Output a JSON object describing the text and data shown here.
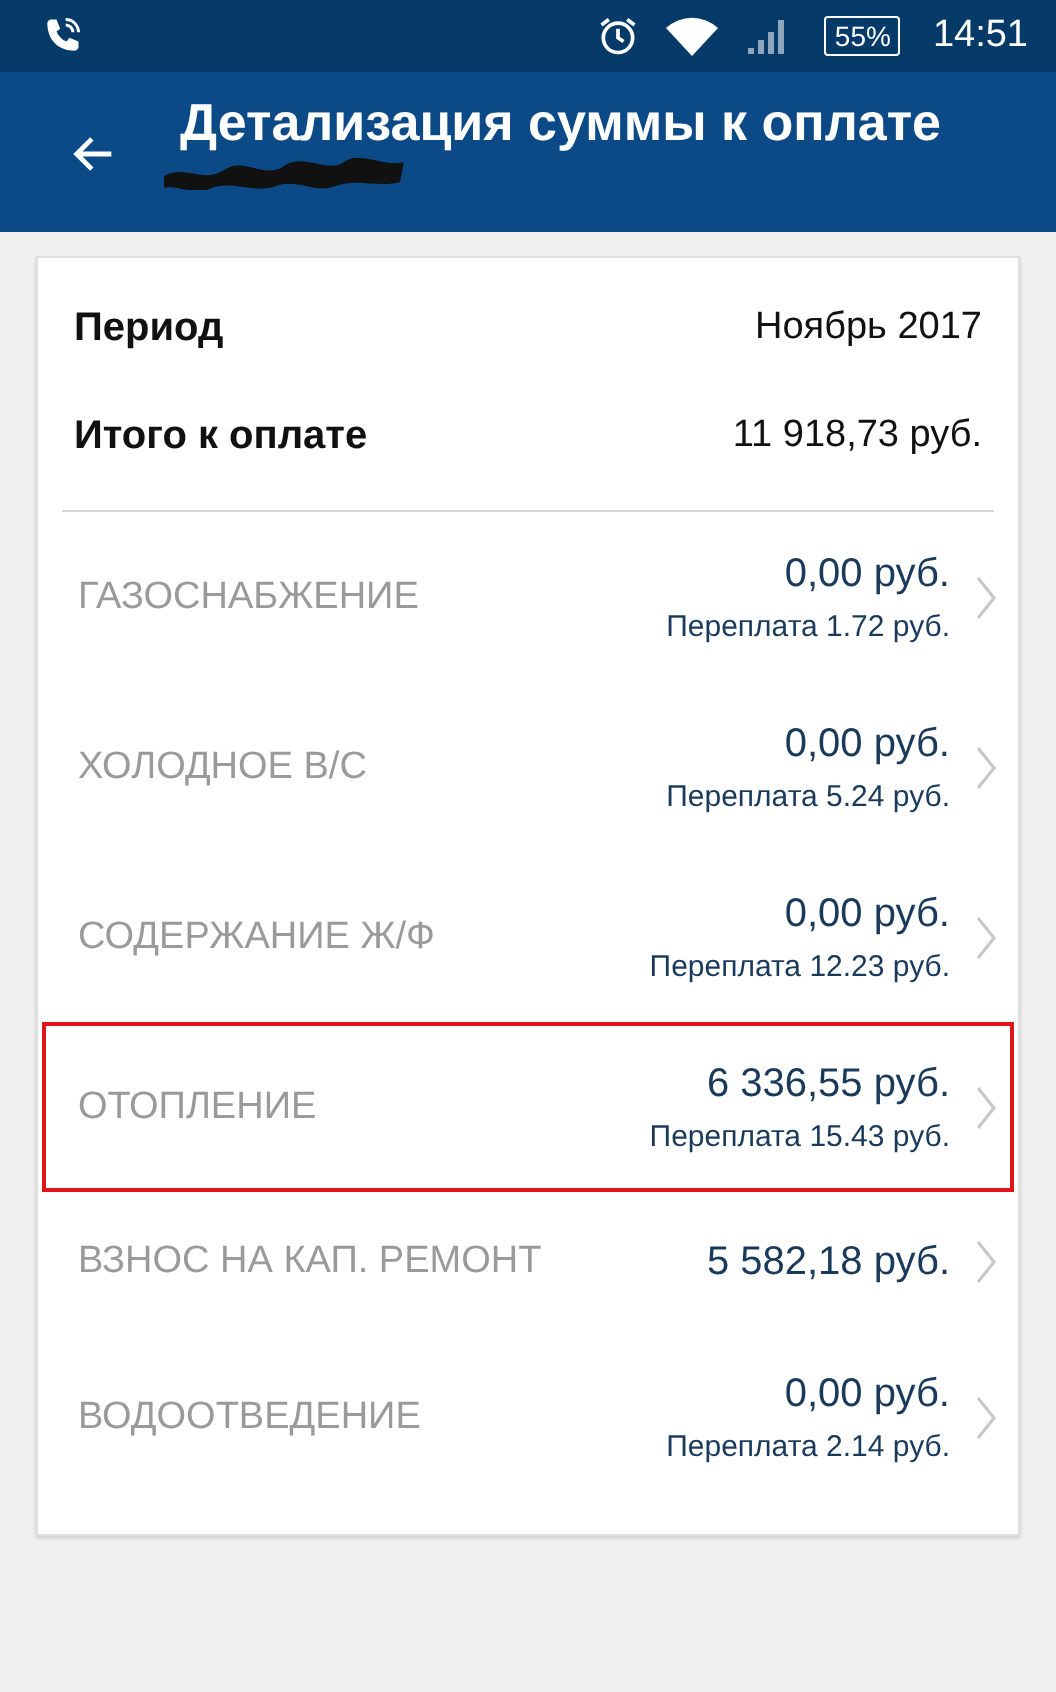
{
  "status_bar": {
    "battery": "55%",
    "time": "14:51"
  },
  "app_bar": {
    "title": "Детализация суммы к оплате",
    "subtitle_redacted": true
  },
  "summary": [
    {
      "label": "Период",
      "value": "Ноябрь 2017"
    },
    {
      "label": "Итого к оплате",
      "value": "11 918,73 руб."
    }
  ],
  "items": [
    {
      "name": "ГАЗОСНАБЖЕНИЕ",
      "amount": "0,00 руб.",
      "note": "Переплата 1.72 руб.",
      "highlighted": false
    },
    {
      "name": "ХОЛОДНОЕ В/С",
      "amount": "0,00 руб.",
      "note": "Переплата 5.24 руб.",
      "highlighted": false
    },
    {
      "name": "СОДЕРЖАНИЕ Ж/Ф",
      "amount": "0,00 руб.",
      "note": "Переплата 12.23 руб.",
      "highlighted": false
    },
    {
      "name": "ОТОПЛЕНИЕ",
      "amount": "6 336,55 руб.",
      "note": "Переплата 15.43 руб.",
      "highlighted": true
    },
    {
      "name": "ВЗНОС НА КАП. РЕМОНТ",
      "amount": "5 582,18 руб.",
      "highlighted": false
    },
    {
      "name": "ВОДООТВЕДЕНИЕ",
      "amount": "0,00 руб.",
      "note": "Переплата 2.14 руб.",
      "highlighted": false
    }
  ]
}
